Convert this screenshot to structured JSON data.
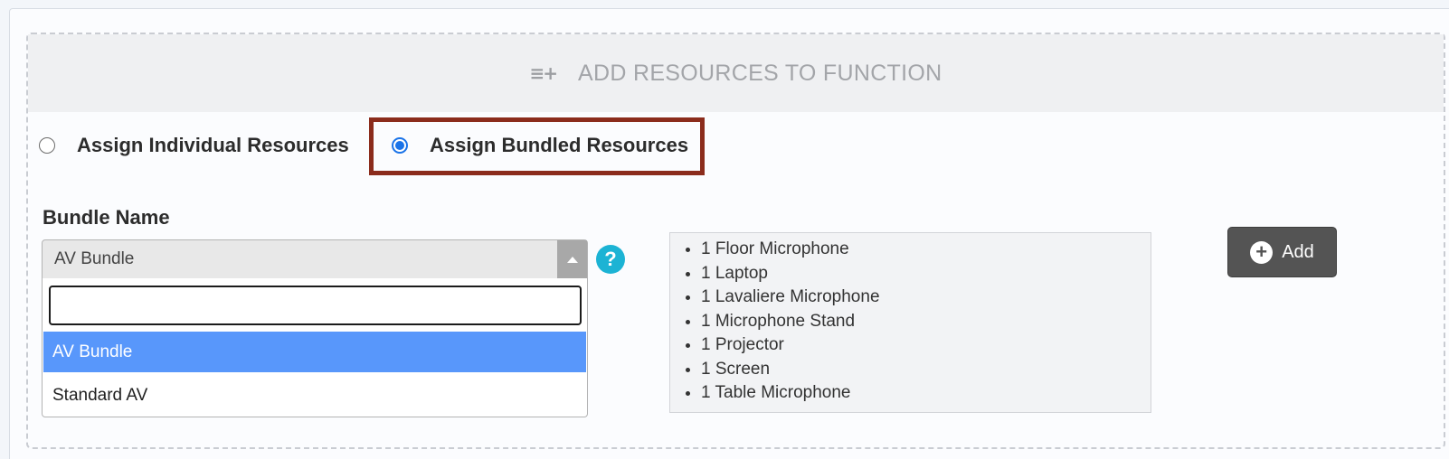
{
  "header": {
    "icon": "list-add-icon",
    "title": "ADD RESOURCES TO FUNCTION"
  },
  "assign_mode": {
    "options": [
      {
        "label": "Assign Individual Resources",
        "checked": false
      },
      {
        "label": "Assign Bundled Resources",
        "checked": true
      }
    ]
  },
  "bundle": {
    "label": "Bundle Name",
    "selected": "AV Bundle",
    "search_value": "",
    "options": [
      {
        "label": "AV Bundle",
        "highlighted": true
      },
      {
        "label": "Standard AV",
        "highlighted": false
      }
    ]
  },
  "help": {
    "icon": "help-icon",
    "glyph": "?"
  },
  "bundle_contents": [
    "1 Floor Microphone",
    "1 Laptop",
    "1 Lavaliere Microphone",
    "1 Microphone Stand",
    "1 Projector",
    "1 Screen",
    "1 Table Microphone"
  ],
  "add_button": {
    "label": "Add",
    "icon": "plus-circle-icon"
  },
  "colors": {
    "highlight_box": "#8b2c1c",
    "selected_option": "#5897fb",
    "help_icon": "#1cb3d4",
    "add_button": "#545454",
    "radio_checked": "#1a73e8"
  }
}
